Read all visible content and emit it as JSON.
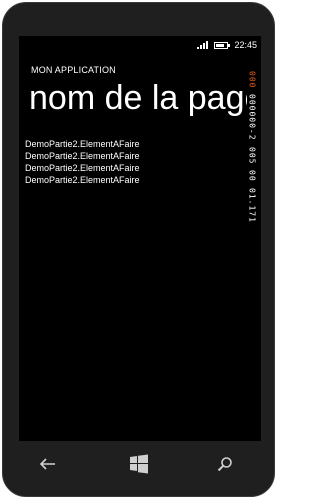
{
  "status": {
    "time": "22:45"
  },
  "header": {
    "app_title": "MON APPLICATION",
    "page_title": "nom de la page"
  },
  "list": {
    "items": [
      "DemoPartie2.ElementAFaire",
      "DemoPartie2.ElementAFaire",
      "DemoPartie2.ElementAFaire",
      "DemoPartie2.ElementAFaire"
    ]
  },
  "counters": [
    {
      "value": "000",
      "color": "#e05a1a"
    },
    {
      "value": "000000-2",
      "color": "#ffffff"
    },
    {
      "value": "005",
      "color": "#ffffff"
    },
    {
      "value": "00",
      "color": "#ffffff"
    },
    {
      "value": "01.171",
      "color": "#ffffff"
    }
  ],
  "hardware": {
    "back": "back-arrow",
    "start": "windows-logo",
    "search": "search"
  }
}
